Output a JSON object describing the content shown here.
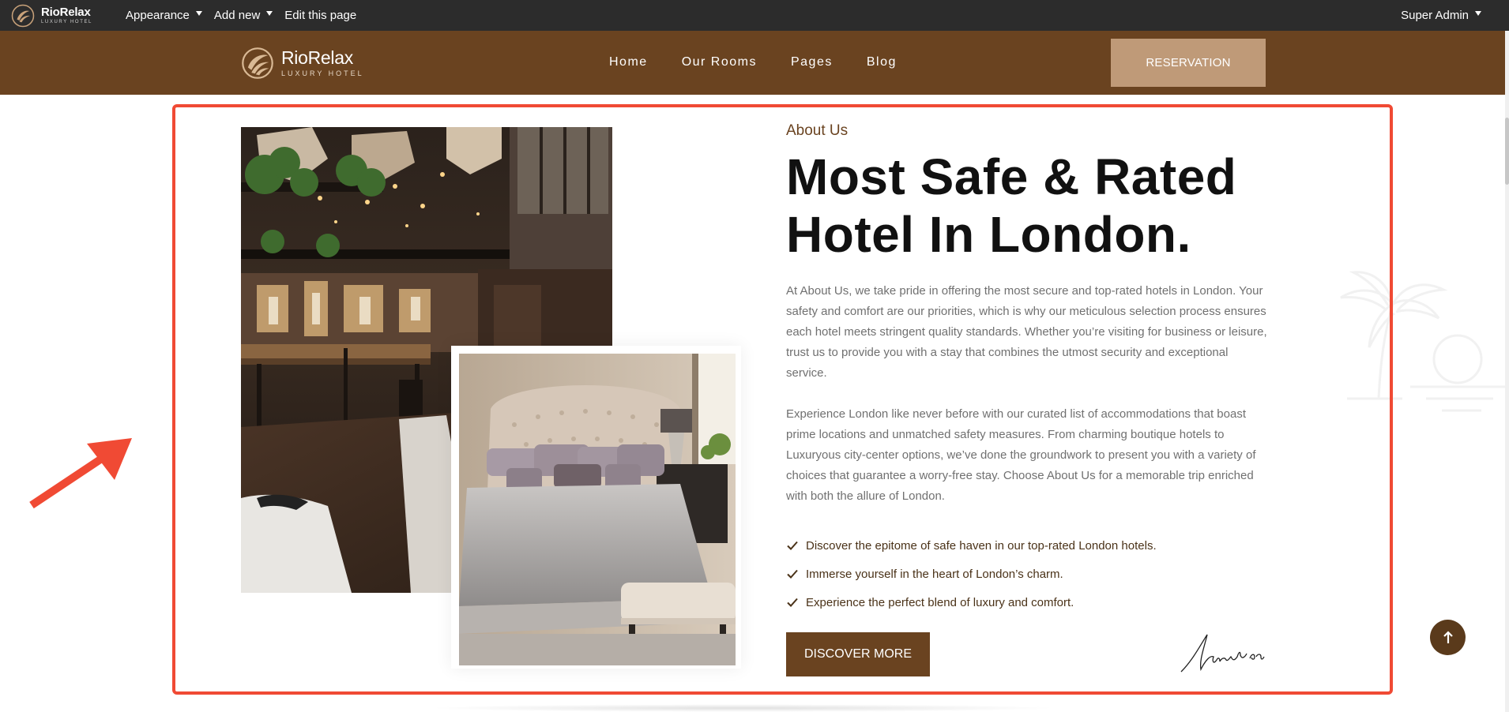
{
  "admin_bar": {
    "logo": {
      "brand": "RioRelax",
      "sub": "LUXURY HOTEL",
      "icon": "palm-leaf-logo-icon"
    },
    "menu": [
      {
        "label": "Appearance",
        "has_dropdown": true
      },
      {
        "label": "Add new",
        "has_dropdown": true
      },
      {
        "label": "Edit this page",
        "has_dropdown": false
      }
    ],
    "user": {
      "label": "Super Admin",
      "has_dropdown": true
    }
  },
  "header": {
    "logo": {
      "brand": "RioRelax",
      "sub": "LUXURY HOTEL"
    },
    "nav": [
      "Home",
      "Our Rooms",
      "Pages",
      "Blog"
    ],
    "reservation_label": "RESERVATION"
  },
  "about": {
    "eyebrow": "About Us",
    "headline_line1": "Most Safe & Rated",
    "headline_line2": "Hotel In London.",
    "paragraph1": "At About Us, we take pride in offering the most secure and top-rated hotels in London. Your safety and comfort are our priorities, which is why our meticulous selection process ensures each hotel meets stringent quality standards. Whether you’re visiting for business or leisure, trust us to provide you with a stay that combines the utmost security and exceptional service.",
    "paragraph2": "Experience London like never before with our curated list of accommodations that boast prime locations and unmatched safety measures. From charming boutique hotels to Luxuryous city-center options, we’ve done the groundwork to present you with a variety of choices that guarantee a worry-free stay. Choose About Us for a memorable trip enriched with both the allure of London.",
    "features": [
      "Discover the epitome of safe haven in our top-rated London hotels.",
      "Immerse yourself in the heart of London’s charm.",
      "Experience the perfect blend of luxury and comfort."
    ],
    "cta_label": "DISCOVER MORE"
  },
  "colors": {
    "brand_brown": "#6a4320",
    "accent_tan": "#bf9a78",
    "admin_bar": "#2c2c2c",
    "highlight_red": "#f04a34"
  },
  "icons": {
    "check": "check-icon",
    "back_to_top": "arrow-up-icon",
    "decorative": "palm-tree-sunset-icon",
    "annotation": "red-arrow-annotation"
  }
}
